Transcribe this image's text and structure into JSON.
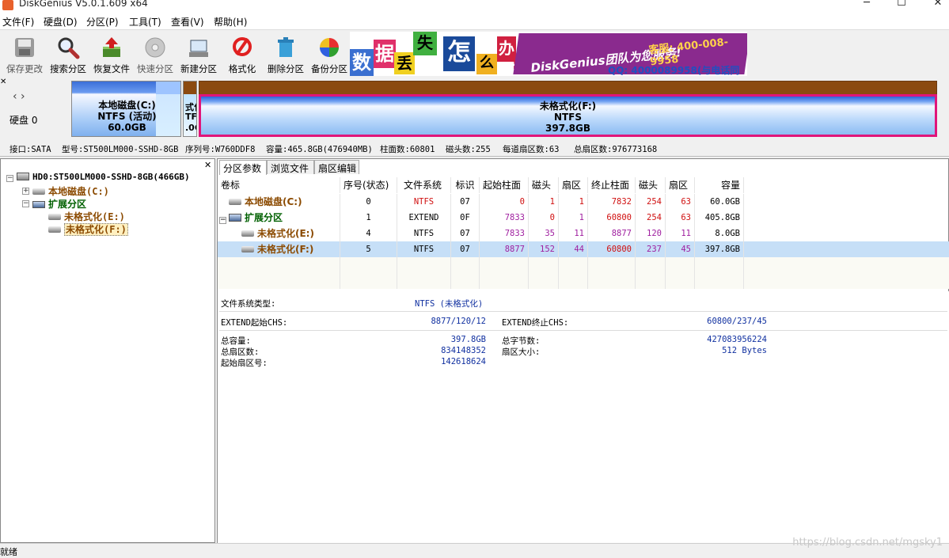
{
  "window": {
    "title": "DiskGenius V5.0.1.609 x64",
    "min": "─",
    "max": "☐",
    "close": "✕"
  },
  "menu": [
    "文件(F)",
    "硬盘(D)",
    "分区(P)",
    "工具(T)",
    "查看(V)",
    "帮助(H)"
  ],
  "toolbar": [
    {
      "label": "保存更改",
      "icon": "save-icon",
      "enabled": false
    },
    {
      "label": "搜索分区",
      "icon": "magnifier-icon",
      "enabled": true
    },
    {
      "label": "恢复文件",
      "icon": "recover-icon",
      "enabled": true
    },
    {
      "label": "快速分区",
      "icon": "disc-icon",
      "enabled": false
    },
    {
      "label": "新建分区",
      "icon": "new-partition-icon",
      "enabled": true
    },
    {
      "label": "格式化",
      "icon": "format-icon",
      "enabled": true
    },
    {
      "label": "删除分区",
      "icon": "trash-icon",
      "enabled": true
    },
    {
      "label": "备份分区",
      "icon": "backup-icon",
      "enabled": true
    }
  ],
  "banner": {
    "tiles": [
      "数",
      "据",
      "丢",
      "失",
      "怎",
      "么",
      "办",
      "!"
    ],
    "slogan": "DiskGenius团队为您服务!",
    "phone": "客服: 400-008-9958",
    "qq": "QQ: 4000089958(与电话同号)"
  },
  "diskmap": {
    "disk_label": "硬盘 0",
    "partitions": [
      {
        "name": "本地磁盘(C:)",
        "fs": "NTFS (活动)",
        "size": "60.0GB"
      },
      {
        "name": "式化",
        "fs": "TFS",
        "size": ".0G"
      },
      {
        "name": "未格式化(F:)",
        "fs": "NTFS",
        "size": "397.8GB"
      }
    ]
  },
  "diskinfo": {
    "iface": "接口:SATA",
    "model": "型号:ST500LM000-SSHD-8GB",
    "serial": "序列号:W760DDF8",
    "capacity": "容量:465.8GB(476940MB)",
    "cylinders": "柱面数:60801",
    "heads": "磁头数:255",
    "sectors_per_track": "每道扇区数:63",
    "total_sectors": "总扇区数:976773168"
  },
  "tree": {
    "disk": "HD0:ST500LM000-SSHD-8GB(466GB)",
    "c": "本地磁盘(C:)",
    "ext": "扩展分区",
    "e": "未格式化(E:)",
    "f": "未格式化(F:)"
  },
  "tabs": [
    "分区参数",
    "浏览文件",
    "扇区编辑"
  ],
  "table": {
    "headers": [
      "卷标",
      "序号(状态)",
      "文件系统",
      "标识",
      "起始柱面",
      "磁头",
      "扇区",
      "终止柱面",
      "磁头",
      "扇区",
      "容量"
    ],
    "rows": [
      [
        "本地磁盘(C:)",
        "0",
        "NTFS",
        "07",
        "0",
        "1",
        "1",
        "7832",
        "254",
        "63",
        "60.0GB"
      ],
      [
        "扩展分区",
        "1",
        "EXTEND",
        "0F",
        "7833",
        "0",
        "1",
        "60800",
        "254",
        "63",
        "405.8GB"
      ],
      [
        "未格式化(E:)",
        "4",
        "NTFS",
        "07",
        "7833",
        "35",
        "11",
        "8877",
        "120",
        "11",
        "8.0GB"
      ],
      [
        "未格式化(F:)",
        "5",
        "NTFS",
        "07",
        "8877",
        "152",
        "44",
        "60800",
        "237",
        "45",
        "397.8GB"
      ]
    ]
  },
  "details": {
    "fs_type_label": "文件系统类型:",
    "fs_type_value": "NTFS (未格式化)",
    "chs_start_label": "EXTEND起始CHS:",
    "chs_start_value": "8877/120/12",
    "chs_end_label": "EXTEND终止CHS:",
    "chs_end_value": "60800/237/45",
    "total_cap_label": "总容量:",
    "total_cap_value": "397.8GB",
    "total_bytes_label": "总字节数:",
    "total_bytes_value": "427083956224",
    "total_sectors_label": "总扇区数:",
    "total_sectors_value": "834148352",
    "sector_size_label": "扇区大小:",
    "sector_size_value": "512 Bytes",
    "start_sector_label": "起始扇区号:",
    "start_sector_value": "142618624"
  },
  "status": "就绪",
  "watermark": "https://blog.csdn.net/mgsky1"
}
